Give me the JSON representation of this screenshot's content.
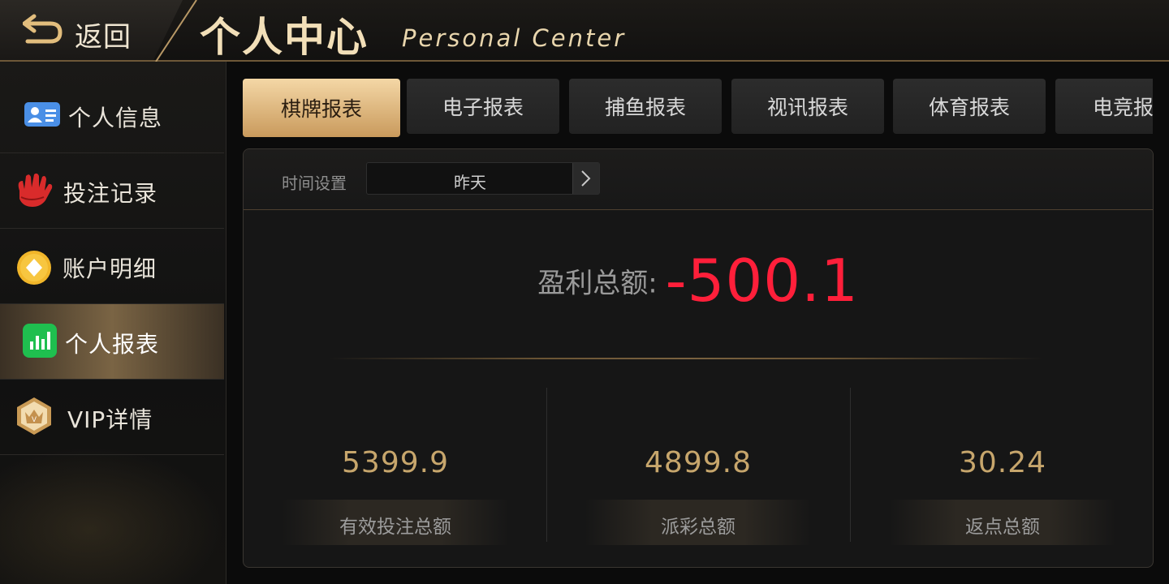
{
  "header": {
    "back_label": "返回",
    "title_cn": "个人中心",
    "title_en": "Personal Center"
  },
  "sidebar": {
    "items": [
      {
        "label": "个人信息",
        "icon": "id-card-icon",
        "active": false
      },
      {
        "label": "投注记录",
        "icon": "hand-icon",
        "active": false
      },
      {
        "label": "账户明细",
        "icon": "coin-diamond-icon",
        "active": false
      },
      {
        "label": "个人报表",
        "icon": "bar-chart-icon",
        "active": true
      },
      {
        "label": "VIP详情",
        "icon": "vip-crown-badge-icon",
        "active": false
      }
    ]
  },
  "tabs": [
    {
      "label": "棋牌报表",
      "active": true
    },
    {
      "label": "电子报表",
      "active": false
    },
    {
      "label": "捕鱼报表",
      "active": false
    },
    {
      "label": "视讯报表",
      "active": false
    },
    {
      "label": "体育报表",
      "active": false
    },
    {
      "label": "电竞报表",
      "active": false
    }
  ],
  "filter": {
    "time_label": "时间设置",
    "time_value": "昨天"
  },
  "summary": {
    "profit_label": "盈利总额:",
    "profit_value": "-500.1"
  },
  "stats": [
    {
      "value": "5399.9",
      "label": "有效投注总额"
    },
    {
      "value": "4899.8",
      "label": "派彩总额"
    },
    {
      "value": "30.24",
      "label": "返点总额"
    }
  ],
  "colors": {
    "accent_gold": "#c7a66c",
    "profit_negative": "#ff1f3a",
    "tab_active": "#e8c48e"
  }
}
